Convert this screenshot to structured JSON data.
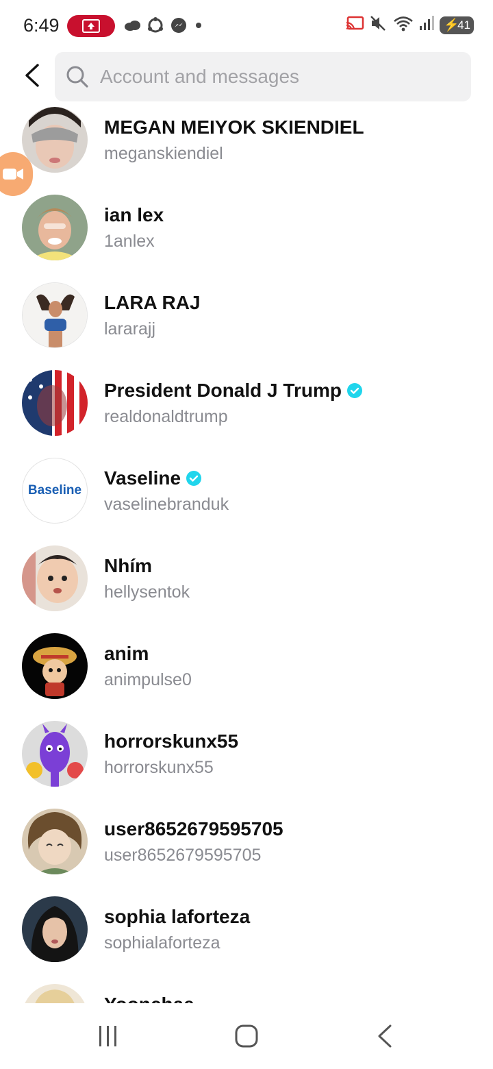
{
  "status_bar": {
    "time": "6:49",
    "battery": "41",
    "icons_left": [
      "screen-record-icon",
      "cloud-icon",
      "sync-icon",
      "messenger-icon",
      "dot-icon"
    ],
    "icons_right": [
      "cast-icon",
      "mute-icon",
      "wifi-icon",
      "signal-icon",
      "battery-icon"
    ]
  },
  "search": {
    "placeholder": "Account and messages",
    "value": ""
  },
  "accounts": [
    {
      "name": "MEGAN MEIYOK SKIENDIEL",
      "username": "meganskiendiel",
      "verified": false
    },
    {
      "name": "ian lex",
      "username": "1anlex",
      "verified": false
    },
    {
      "name": "LARA RAJ",
      "username": "lararajj",
      "verified": false
    },
    {
      "name": "President Donald J Trump",
      "username": "realdonaldtrump",
      "verified": true
    },
    {
      "name": "Vaseline",
      "username": "vaselinebranduk",
      "verified": true
    },
    {
      "name": "Nhím",
      "username": "hellysentok",
      "verified": false
    },
    {
      "name": "anim",
      "username": "animpulse0",
      "verified": false
    },
    {
      "name": "horrorskunx55",
      "username": "horrorskunx55",
      "verified": false
    },
    {
      "name": "user8652679595705",
      "username": "user8652679595705",
      "verified": false
    },
    {
      "name": "sophia laforteza",
      "username": "sophialaforteza",
      "verified": false
    },
    {
      "name": "Yoonchae",
      "username": "",
      "verified": false
    }
  ],
  "avatar_logo_text": "Baseline",
  "colors": {
    "verified": "#20d5ec",
    "record_pill": "#c8102e",
    "floating_camera": "#f7a66b"
  },
  "nav": [
    "recents-icon",
    "home-icon",
    "back-icon"
  ]
}
